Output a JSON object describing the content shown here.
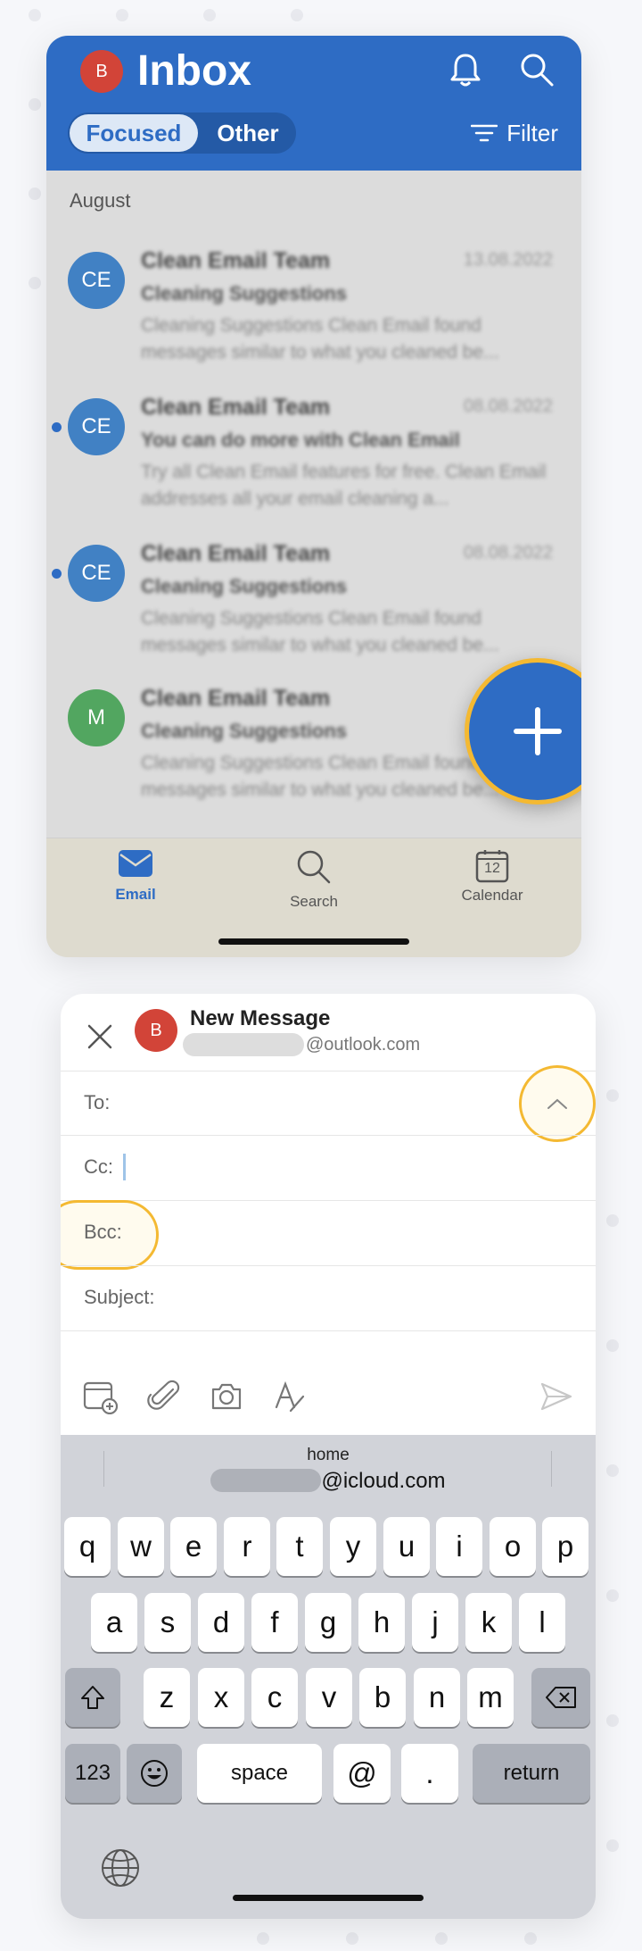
{
  "inbox": {
    "avatar_initial": "B",
    "title": "Inbox",
    "tabs": {
      "focused": "Focused",
      "other": "Other"
    },
    "filter_label": "Filter",
    "section": "August",
    "messages": [
      {
        "initials": "CE",
        "avatar_color": "#4181c4",
        "unread": false,
        "sender": "Clean Email Team",
        "date": "13.08.2022",
        "subject": "Cleaning Suggestions",
        "preview": "Cleaning Suggestions Clean Email found messages similar to what you cleaned be..."
      },
      {
        "initials": "CE",
        "avatar_color": "#4181c4",
        "unread": true,
        "sender": "Clean Email Team",
        "date": "08.08.2022",
        "subject": "You can do more with Clean Email",
        "preview": "Try all Clean Email features for free. Clean Email addresses all your email cleaning a..."
      },
      {
        "initials": "CE",
        "avatar_color": "#4181c4",
        "unread": true,
        "sender": "Clean Email Team",
        "date": "08.08.2022",
        "subject": "Cleaning Suggestions",
        "preview": "Cleaning Suggestions Clean Email found messages similar to what you cleaned be..."
      },
      {
        "initials": "M",
        "avatar_color": "#52a660",
        "unread": false,
        "sender": "Clean Email Team",
        "date": "",
        "subject": "Cleaning Suggestions",
        "preview": "Cleaning Suggestions Clean Email found messages similar to what you cleaned be..."
      }
    ],
    "tabbar": {
      "email": "Email",
      "search": "Search",
      "calendar": "Calendar",
      "calendar_day": "12"
    }
  },
  "compose": {
    "avatar_initial": "B",
    "title": "New Message",
    "from_suffix": "@outlook.com",
    "fields": {
      "to": "To:",
      "cc": "Cc:",
      "bcc": "Bcc:",
      "subject": "Subject:"
    }
  },
  "keyboard": {
    "suggestion_label": "home",
    "suggestion_suffix": "@icloud.com",
    "row1": [
      "q",
      "w",
      "e",
      "r",
      "t",
      "y",
      "u",
      "i",
      "o",
      "p"
    ],
    "row2": [
      "a",
      "s",
      "d",
      "f",
      "g",
      "h",
      "j",
      "k",
      "l"
    ],
    "row3": [
      "z",
      "x",
      "c",
      "v",
      "b",
      "n",
      "m"
    ],
    "numbers": "123",
    "space": "space",
    "at": "@",
    "dot": ".",
    "return": "return"
  },
  "colors": {
    "brand_blue": "#2e6cc4",
    "highlight": "#f4b932",
    "avatar_red": "#d24438"
  }
}
